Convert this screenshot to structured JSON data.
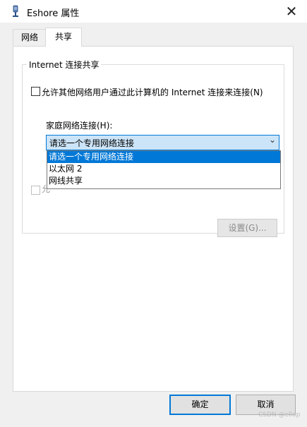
{
  "window": {
    "title": "Eshore 属性",
    "close_glyph": "✕"
  },
  "tabs": [
    {
      "label": "网络",
      "active": false
    },
    {
      "label": "共享",
      "active": true
    }
  ],
  "group": {
    "title": "Internet 连接共享",
    "allow_share_label": "允许其他网络用户通过此计算机的 Internet 连接来连接(N)",
    "allow_share_checked": false,
    "home_network_label": "家庭网络连接(H):",
    "home_network_selected": "请选一个专用网络连接",
    "dropdown_options": [
      "请选一个专用网络连接",
      "以太网 2",
      "网线共享"
    ],
    "dropdown_selected_index": 0,
    "second_checkbox_partial": "允",
    "settings_label": "设置(G)..."
  },
  "buttons": {
    "ok_label": "确定",
    "cancel_label": "取消"
  },
  "watermark": "CSDN @ellop",
  "colors": {
    "accent": "#0078d7",
    "selected_bg": "#cce4f7"
  },
  "icons": {
    "title": "network-adapter-icon",
    "close": "close-icon",
    "chevron": "chevron-down-icon"
  }
}
